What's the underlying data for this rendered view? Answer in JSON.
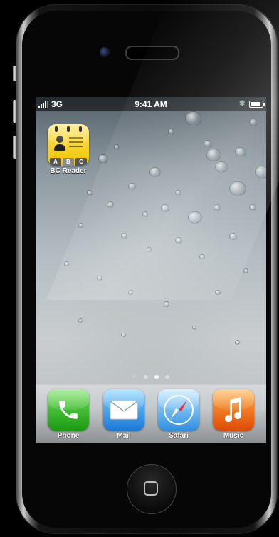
{
  "status_bar": {
    "carrier": "3G",
    "time": "9:41 AM",
    "battery_level": 0.85
  },
  "home_screen": {
    "apps": [
      {
        "label": "BC Reader",
        "icon": "bc-reader-icon",
        "tabs": [
          "A",
          "B",
          "C"
        ]
      }
    ],
    "page_count": 3,
    "active_page": 2
  },
  "dock": {
    "apps": [
      {
        "label": "Phone",
        "icon": "phone-icon"
      },
      {
        "label": "Mail",
        "icon": "mail-icon"
      },
      {
        "label": "Safari",
        "icon": "safari-icon"
      },
      {
        "label": "Music",
        "icon": "music-icon"
      }
    ]
  },
  "colors": {
    "bc_reader": "#f5d21a",
    "phone": "#34c21f",
    "mail": "#3a9af0",
    "safari": "#4aa8f0",
    "music": "#f06a10"
  }
}
